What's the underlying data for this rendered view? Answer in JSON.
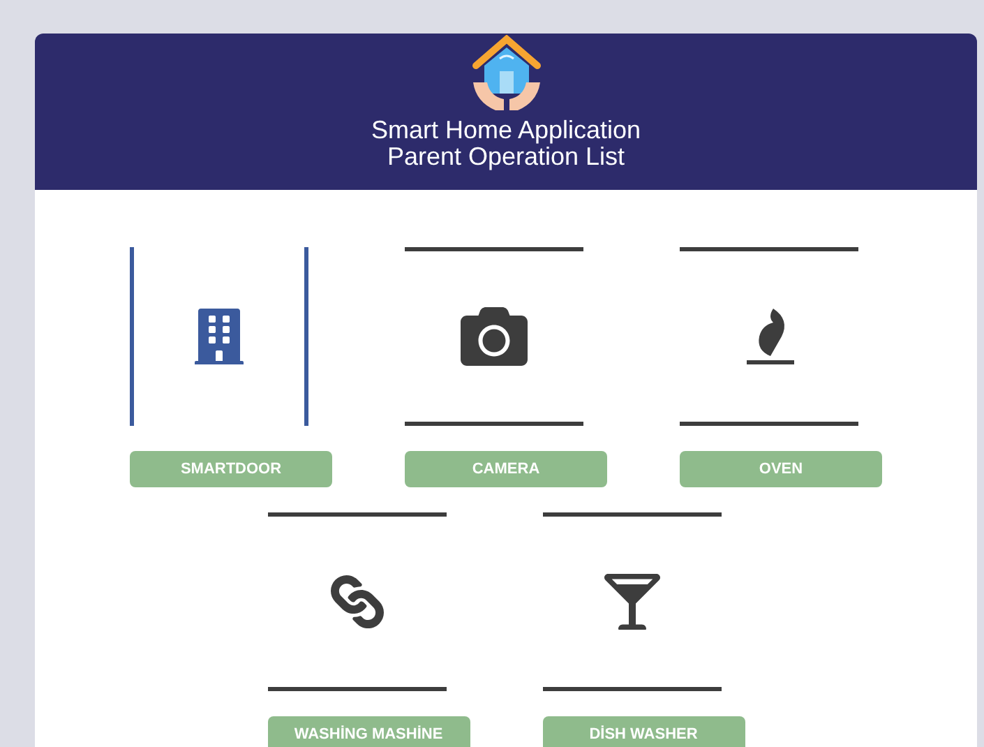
{
  "header": {
    "title_line1": "Smart Home Application",
    "title_line2": "Parent Operation List"
  },
  "devices": [
    {
      "kind": "building",
      "label": "SMARTDOOR",
      "selected": true
    },
    {
      "kind": "camera",
      "label": "CAMERA",
      "selected": false
    },
    {
      "kind": "flame",
      "label": "OVEN",
      "selected": false
    },
    {
      "kind": "chain",
      "label": "WASHİNG MASHİNE",
      "selected": false
    },
    {
      "kind": "glass",
      "label": "DİSH WASHER",
      "selected": false
    }
  ]
}
